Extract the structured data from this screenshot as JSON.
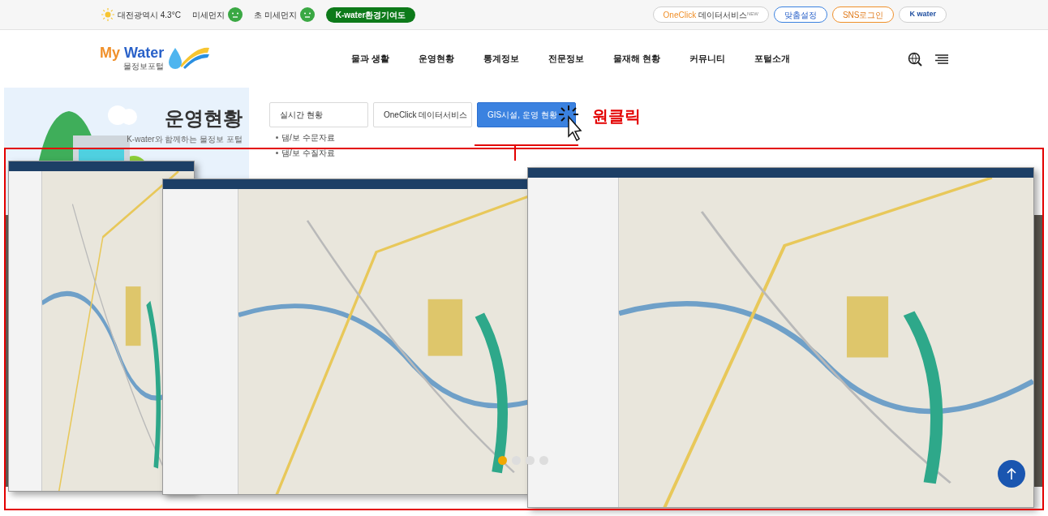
{
  "top_bar": {
    "weather": "대전광역시 4.3°C",
    "dust": [
      {
        "label": "미세먼지",
        "color": "#3aa843"
      },
      {
        "label": "초 미세먼지",
        "color": "#3aa843"
      }
    ],
    "contribution_button": "K-water환경기여도",
    "links": [
      {
        "kind": "oneclick",
        "accent": "OneClick",
        "label": "데이터서비스",
        "sup": "NEW"
      },
      {
        "kind": "blue",
        "label": "맞춤설정"
      },
      {
        "kind": "orange",
        "label": "SNS로그인"
      },
      {
        "kind": "logo",
        "label": "K water"
      }
    ]
  },
  "header": {
    "logo": {
      "title": "My Water",
      "subtitle": "물정보포털"
    },
    "nav": [
      "물과 생활",
      "운영현황",
      "통계정보",
      "전문정보",
      "물재해 현황",
      "커뮤니티",
      "포털소개"
    ]
  },
  "banner": {
    "title": "운영현황",
    "subtitle": "K-water와 함께하는 물정보 포털"
  },
  "tabs": [
    {
      "label": "실시간 현황",
      "selected": false
    },
    {
      "label": "OneClick 데이터서비스",
      "selected": false
    },
    {
      "label": "GIS시설, 운영 현황",
      "selected": true
    }
  ],
  "annotation": "원클릭",
  "sub_links": [
    "댐/보 수문자료",
    "댐/보 수질자료"
  ],
  "carousel": {
    "dots": [
      {
        "selected": true
      },
      {
        "selected": false
      },
      {
        "selected": false
      },
      {
        "selected": false
      }
    ]
  }
}
